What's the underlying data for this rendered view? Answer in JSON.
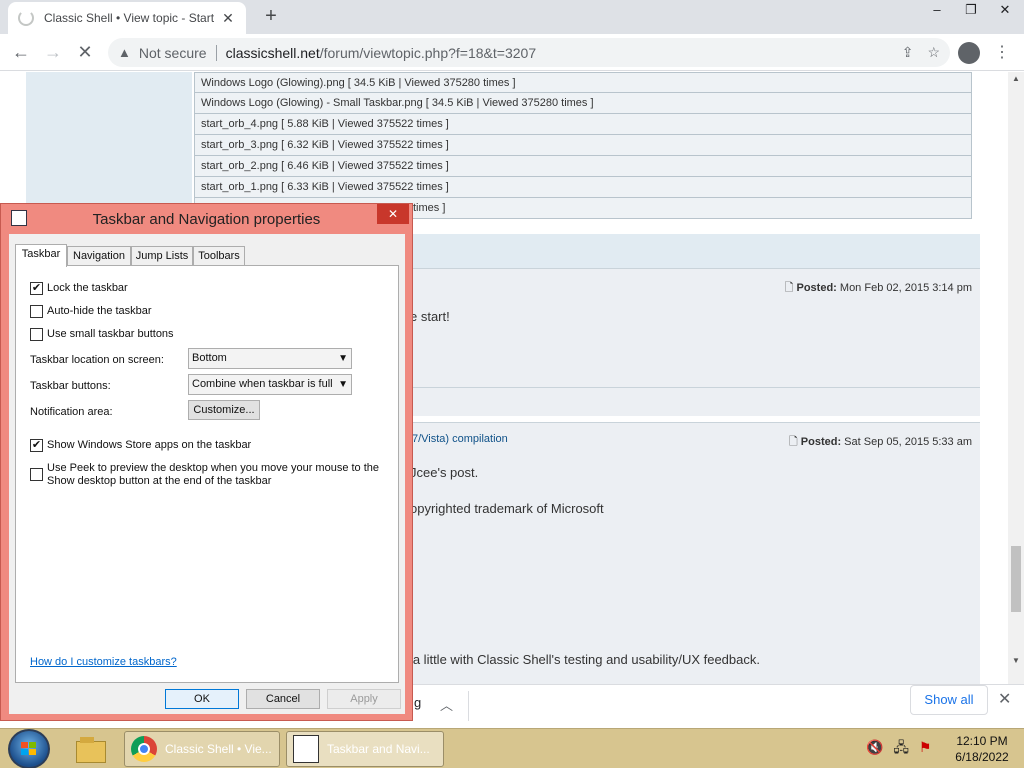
{
  "browser": {
    "tab_title": "Classic Shell • View topic - Start",
    "new_tab": "+",
    "security_label": "Not secure",
    "url_host": "classicshell.net",
    "url_path": "/forum/viewtopic.php?f=18&t=3207",
    "window_controls": {
      "minimize": "–",
      "restore": "❐",
      "close": "✕"
    }
  },
  "page": {
    "attachments": [
      "Windows Logo (Glowing).png [ 34.5 KiB | Viewed 375280 times ]",
      "Windows Logo (Glowing) - Small Taskbar.png [ 34.5 KiB | Viewed 375280 times ]",
      "start_orb_4.png [ 5.88 KiB | Viewed 375522 times ]",
      "start_orb_3.png [ 6.32 KiB | Viewed 375522 times ]",
      "start_orb_2.png [ 6.46 KiB | Viewed 375522 times ]",
      "start_orb_1.png [ 6.33 KiB | Viewed 375522 times ]",
      "times ]"
    ],
    "post1": {
      "posted_label": "Posted:",
      "posted_date": "Mon Feb 02, 2015 3:14 pm",
      "text": "e start!"
    },
    "post2": {
      "subject_fragment": "7/Vista) compilation",
      "posted_label": "Posted:",
      "posted_date": "Sat Sep 05, 2015 5:33 am",
      "line1": "Jcee's post.",
      "line2": "opyrighted trademark of Microsoft",
      "line3": "d a little with Classic Shell's testing and usability/UX feedback."
    }
  },
  "downloads": {
    "partial_label": "g",
    "show_all": "Show all",
    "close": "✕"
  },
  "dialog": {
    "title": "Taskbar and Navigation properties",
    "close": "✕",
    "tabs": [
      "Taskbar",
      "Navigation",
      "Jump Lists",
      "Toolbars"
    ],
    "checkboxes": {
      "lock": {
        "label": "Lock the taskbar",
        "checked": true
      },
      "autohide": {
        "label": "Auto-hide the taskbar",
        "checked": false
      },
      "small": {
        "label": "Use small taskbar buttons",
        "checked": false
      },
      "store": {
        "label": "Show Windows Store apps on the taskbar",
        "checked": true
      },
      "peek": {
        "label": "Use Peek to preview the desktop when you move your mouse to the Show desktop button at the end of the taskbar",
        "checked": false
      }
    },
    "location_label": "Taskbar location on screen:",
    "location_value": "Bottom",
    "buttons_label": "Taskbar buttons:",
    "buttons_value": "Combine when taskbar is full",
    "notification_label": "Notification area:",
    "customize": "Customize...",
    "help_link": "How do I customize taskbars?",
    "ok": "OK",
    "cancel": "Cancel",
    "apply": "Apply"
  },
  "taskbar": {
    "task1": "Classic Shell • Vie...",
    "task2": "Taskbar and Navi...",
    "time": "12:10 PM",
    "date": "6/18/2022"
  },
  "colors": {
    "dialog_frame": "#f08a80",
    "taskbar": "#d7c58f",
    "forum_band": "#e1ebf2"
  }
}
